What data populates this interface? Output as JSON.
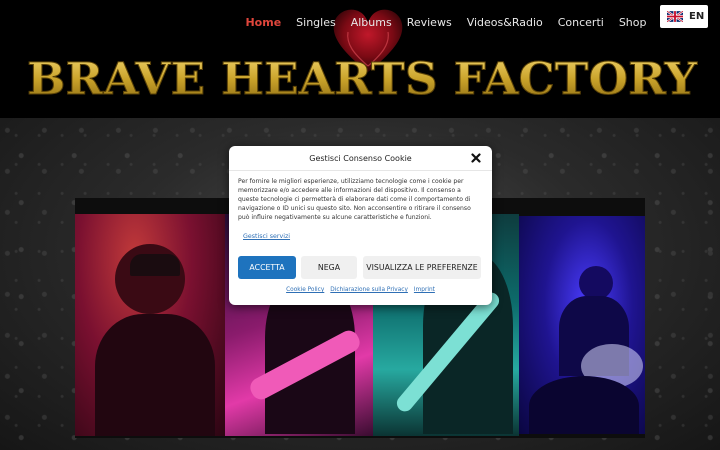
{
  "nav": {
    "items": [
      {
        "label": "Home",
        "active": true
      },
      {
        "label": "Singles",
        "active": false
      },
      {
        "label": "Albums",
        "active": false
      },
      {
        "label": "Reviews",
        "active": false
      },
      {
        "label": "Videos&Radio",
        "active": false
      },
      {
        "label": "Concerti",
        "active": false
      },
      {
        "label": "Shop",
        "active": false
      }
    ],
    "active_color": "#e0463c"
  },
  "language": {
    "label": "EN",
    "icon": "uk-flag-icon"
  },
  "logo": {
    "text": "BRAVE HEARTS FACTORY",
    "color": "#c9a22a"
  },
  "cookie_modal": {
    "title": "Gestisci Consenso Cookie",
    "body": "Per fornire le migliori esperienze, utilizziamo tecnologie come i cookie per memorizzare e/o accedere alle informazioni del dispositivo. Il consenso a queste tecnologie ci permetterà di elaborare dati come il comportamento di navigazione o ID unici su questo sito. Non acconsentire o ritirare il consenso può influire negativamente su alcune caratteristiche e funzioni.",
    "services_link": "Gestisci servizi",
    "accept_label": "ACCETTA",
    "deny_label": "NEGA",
    "preferences_label": "VISUALIZZA LE PREFERENZE",
    "footer_links": [
      "Cookie Policy",
      "Dichiarazione sulla Privacy",
      "Imprint"
    ],
    "accent_color": "#1e73be"
  }
}
